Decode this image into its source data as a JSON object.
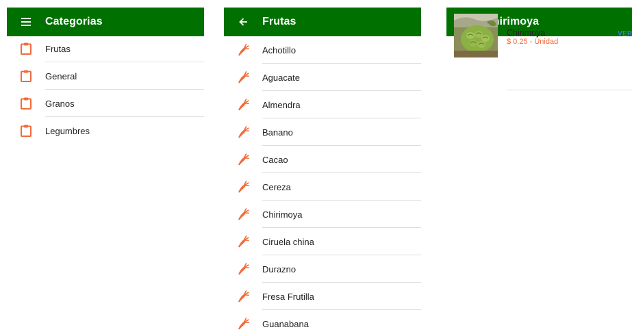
{
  "colors": {
    "appbar_bg": "#007000",
    "icon_orange": "#f26a3a",
    "price_orange": "#f26a3a",
    "link_blue": "#3c78d8",
    "divider": "#dddddd"
  },
  "screen_categories": {
    "nav_icon": "menu-icon",
    "title": "Categorias",
    "item_icon": "clipboard-icon",
    "items": [
      {
        "label": "Frutas"
      },
      {
        "label": "General"
      },
      {
        "label": "Granos"
      },
      {
        "label": "Legumbres"
      }
    ]
  },
  "screen_frutas": {
    "nav_icon": "back-arrow-icon",
    "title": "Frutas",
    "item_icon": "carrot-icon",
    "items": [
      {
        "label": "Achotillo"
      },
      {
        "label": "Aguacate"
      },
      {
        "label": "Almendra"
      },
      {
        "label": "Banano"
      },
      {
        "label": "Cacao"
      },
      {
        "label": "Cereza"
      },
      {
        "label": "Chirimoya"
      },
      {
        "label": "Ciruela china"
      },
      {
        "label": "Durazno"
      },
      {
        "label": "Fresa Frutilla"
      },
      {
        "label": "Guanabana"
      }
    ]
  },
  "screen_chirimoya": {
    "nav_icon": "back-arrow-icon",
    "title": "Chirimoya",
    "product": {
      "name": "Chirimoya",
      "price": "$ 0.25 - Unidad",
      "action": "VER"
    }
  }
}
